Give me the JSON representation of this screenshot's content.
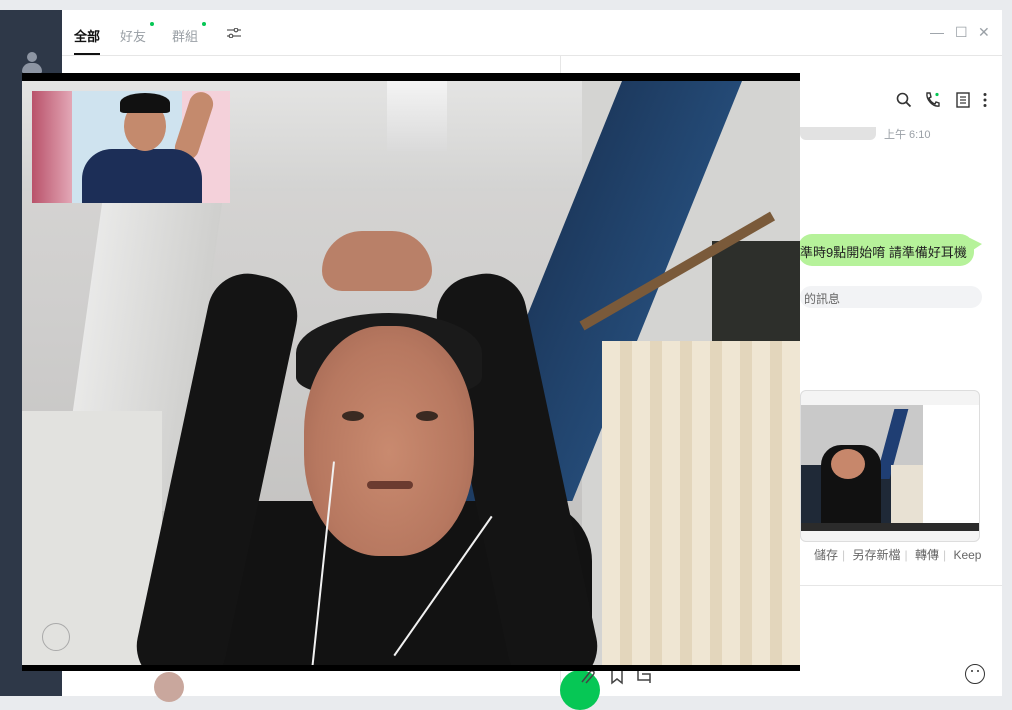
{
  "tabs": [
    {
      "label": "全部",
      "active": true
    },
    {
      "label": "好友",
      "active": false,
      "has_dot": true
    },
    {
      "label": "群組",
      "active": false,
      "has_dot": true
    }
  ],
  "icons": {
    "filter": "filter-icon",
    "search": "search-icon",
    "call": "phone-icon",
    "notes": "notes-icon",
    "more": "more-icon",
    "emoji": "emoji-icon"
  },
  "window_controls": {
    "minimize": "—",
    "maximize": "☐",
    "close": "✕"
  },
  "chat": {
    "time": "上午 6:10",
    "message": "準時9點開始唷 請準備好耳機",
    "notice": "的訊息"
  },
  "image_actions": [
    "儲存",
    "另存新檔",
    "轉傳",
    "Keep"
  ],
  "colors": {
    "accent_green": "#06c755",
    "bubble_green": "#b6f29a",
    "rail": "#2e3848"
  }
}
